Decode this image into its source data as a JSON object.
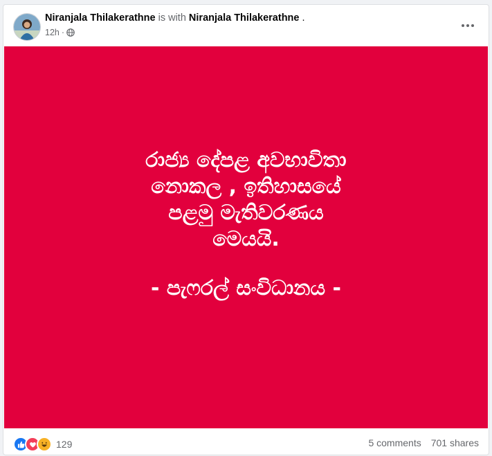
{
  "post": {
    "author": "Niranjala Thilakerathne",
    "with_text": "is with",
    "tagged": "Niranjala Thilakerathne",
    "tail": ".",
    "time": "12h",
    "dot": "·",
    "privacy_icon": "globe-icon",
    "menu_icon": "more-options-icon"
  },
  "banner": {
    "background": "#e2003d",
    "quote": "රාජ්‍ය දේපළ අවභාවිතා නොකල , ඉතිහාසයේ පළමු මැතිවරණය මෙයයි.",
    "signature": "- පැෆරල් සංවිධානය -"
  },
  "footer": {
    "reaction_icons": [
      "like-icon",
      "love-icon",
      "haha-icon"
    ],
    "reaction_count": "129",
    "comments": "5 comments",
    "shares": "701 shares"
  }
}
